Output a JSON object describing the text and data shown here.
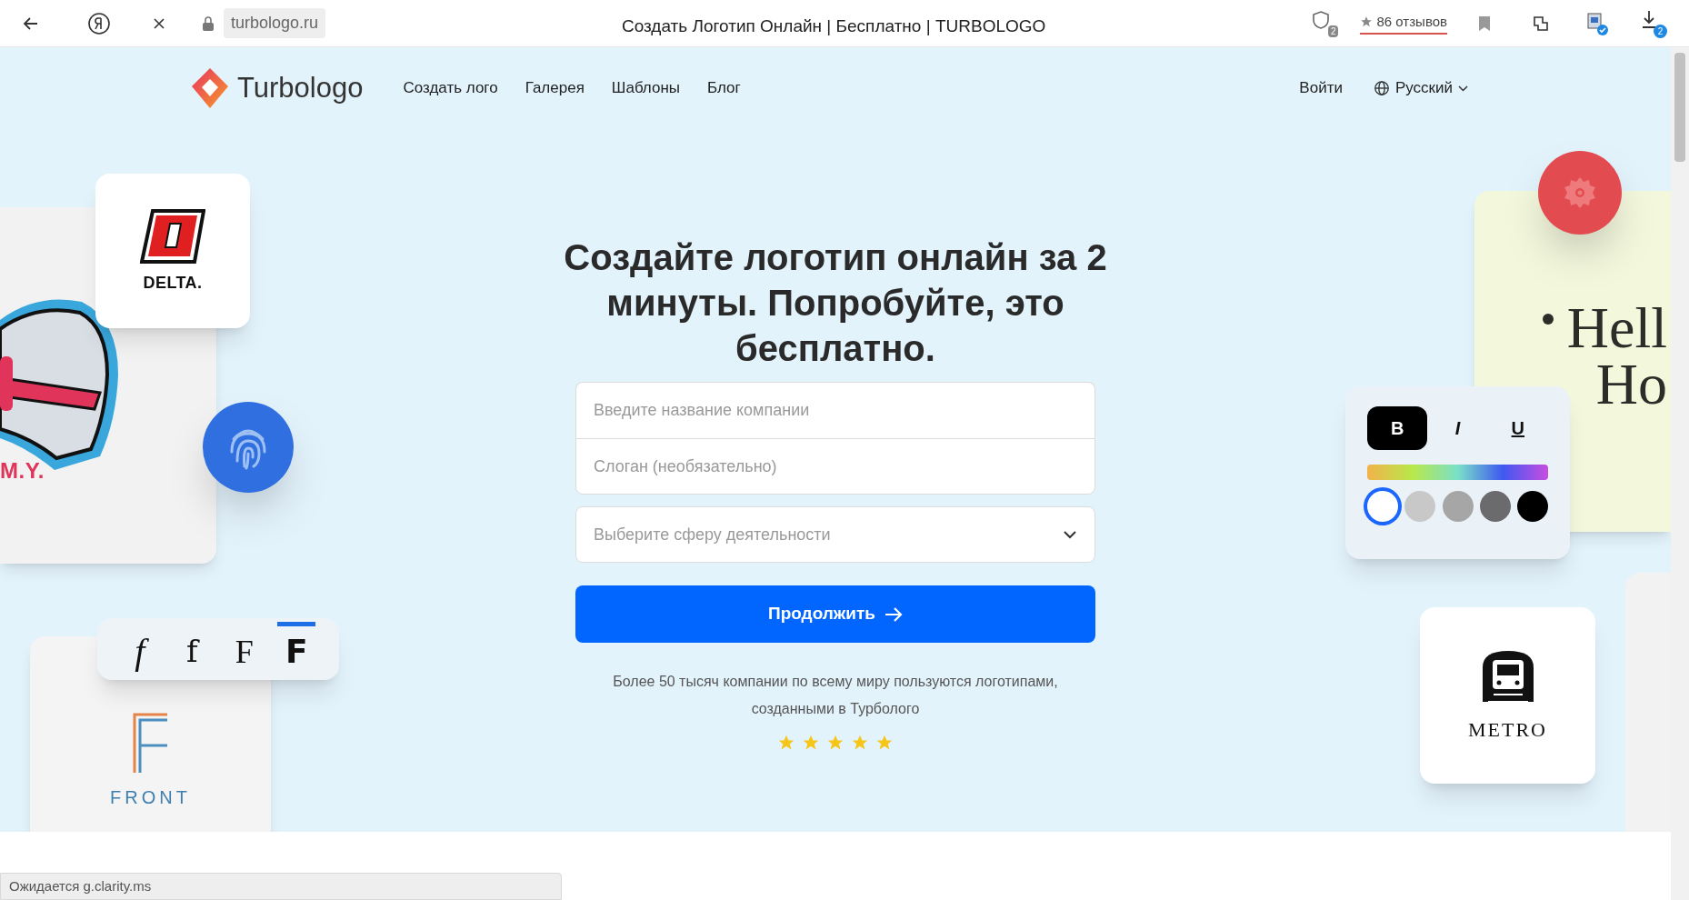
{
  "browser": {
    "address": "turbologo.ru",
    "title": "Создать Логотип Онлайн | Бесплатно | TURBOLOGO",
    "tabs_count": "2",
    "reviews": "86 отзывов",
    "downloads_count": "2"
  },
  "nav": {
    "brand": "Turbologo",
    "links": [
      "Создать лого",
      "Галерея",
      "Шаблоны",
      "Блог"
    ],
    "login": "Войти",
    "language": "Русский"
  },
  "hero": {
    "heading": "Создайте логотип онлайн за 2 минуты. Попробуйте, это бесплатно.",
    "fields": [
      {
        "placeholder": "Введите название компании"
      },
      {
        "placeholder": "Слоган (необязательно)"
      }
    ],
    "select": {
      "placeholder": "Выберите сферу деятельности"
    },
    "button": "Продолжить",
    "note": "Более 50 тысяч компании по всему миру пользуются логотипами, созданными в Турболого",
    "stars": 5
  },
  "decor": {
    "delta": "DELTA.",
    "my": "M.Y.",
    "fonts": [
      {
        "label": "f",
        "kind": "serif",
        "selected": false
      },
      {
        "label": "f",
        "kind": "slim",
        "selected": false
      },
      {
        "label": "F",
        "kind": "caps",
        "selected": false
      },
      {
        "label": "F",
        "kind": "sans",
        "selected": true
      }
    ],
    "front": "FRONT",
    "format": [
      {
        "label": "B",
        "kind": "bold",
        "selected": true
      },
      {
        "label": "I",
        "kind": "italic",
        "selected": false
      },
      {
        "label": "U",
        "kind": "underline",
        "selected": false
      }
    ],
    "swatches": [
      {
        "color": "#ffffff",
        "selected": true
      },
      {
        "color": "#c8c8c8",
        "selected": false
      },
      {
        "color": "#a6a6a6",
        "selected": false
      },
      {
        "color": "#6b6b6e",
        "selected": false
      },
      {
        "color": "#000000",
        "selected": false
      }
    ],
    "hello": [
      "Hell",
      "Ho"
    ],
    "metro": "METRO"
  },
  "status_bar": "Ожидается g.clarity.ms"
}
